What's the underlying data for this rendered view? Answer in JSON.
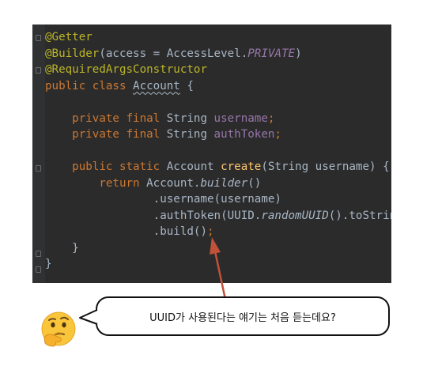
{
  "code_lines": [
    [
      {
        "t": "@Getter",
        "c": "ann"
      }
    ],
    [
      {
        "t": "@Builder",
        "c": "ann"
      },
      {
        "t": "(access = AccessLevel.",
        "c": "plain"
      },
      {
        "t": "PRIVATE",
        "c": "fld ital"
      },
      {
        "t": ")",
        "c": "plain"
      }
    ],
    [
      {
        "t": "@RequiredArgsConstructor",
        "c": "ann"
      }
    ],
    [
      {
        "t": "public class ",
        "c": "kw"
      },
      {
        "t": "Account",
        "c": "plain squig"
      },
      {
        "t": " {",
        "c": "plain"
      }
    ],
    [],
    [
      {
        "t": "    private final ",
        "c": "kw"
      },
      {
        "t": "String ",
        "c": "plain"
      },
      {
        "t": "username",
        "c": "fld"
      },
      {
        "t": ";",
        "c": "kw"
      }
    ],
    [
      {
        "t": "    private final ",
        "c": "kw"
      },
      {
        "t": "String ",
        "c": "plain"
      },
      {
        "t": "authToken",
        "c": "fld"
      },
      {
        "t": ";",
        "c": "kw"
      }
    ],
    [],
    [
      {
        "t": "    public static ",
        "c": "kw"
      },
      {
        "t": "Account ",
        "c": "plain"
      },
      {
        "t": "create",
        "c": "mth"
      },
      {
        "t": "(String username) {",
        "c": "plain"
      }
    ],
    [
      {
        "t": "        return ",
        "c": "kw"
      },
      {
        "t": "Account.",
        "c": "plain"
      },
      {
        "t": "builder",
        "c": "plain st"
      },
      {
        "t": "()",
        "c": "plain"
      }
    ],
    [
      {
        "t": "                .username(username)",
        "c": "plain"
      }
    ],
    [
      {
        "t": "                .authToken(UUID.",
        "c": "plain"
      },
      {
        "t": "randomUUID",
        "c": "plain st"
      },
      {
        "t": "().toString())",
        "c": "plain"
      }
    ],
    [
      {
        "t": "                .build()",
        "c": "plain"
      },
      {
        "t": ";",
        "c": "kw"
      }
    ],
    [
      {
        "t": "    }",
        "c": "plain"
      }
    ],
    [
      {
        "t": "}",
        "c": "plain"
      }
    ]
  ],
  "bubble": {
    "text": "UUID가 사용된다는 얘기는 처음 듣는데요?"
  },
  "colors": {
    "editor_bg": "#2b2b2b",
    "annotation": "#bbb529",
    "keyword": "#cc7832",
    "field": "#9876aa",
    "method": "#ffc66d",
    "text": "#a9b7c6",
    "arrow": "#c0523a"
  },
  "icons": {
    "emoji": "thinking-face-icon"
  }
}
